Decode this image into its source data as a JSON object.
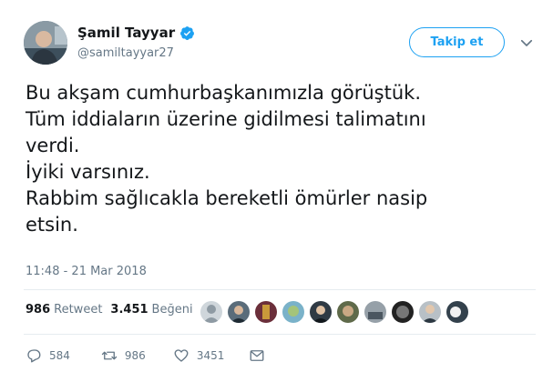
{
  "tweet": {
    "author": {
      "display_name": "Şamil Tayyar",
      "handle": "@samiltayyar27",
      "verified": true,
      "avatar": "avatar-photo"
    },
    "follow_button": "Takip et",
    "menu_icon": "chevron-down-icon",
    "text": "Bu akşam cumhurbaşkanımızla görüştük.\nTüm iddiaların üzerine gidilmesi talimatını\nverdi.\nİyiki varsınız.\nRabbim sağlıcakla bereketli ömürler nasip\netsin.",
    "timestamp": "11:48 - 21 Mar 2018",
    "stats": {
      "retweets_count": "986",
      "retweets_label": "Retweet",
      "likes_count": "3.451",
      "likes_label": "Beğeni"
    },
    "likers_avatar_count": 10,
    "actions": {
      "reply_count": "584",
      "retweet_count": "986",
      "like_count": "3451",
      "reply_icon": "reply-icon",
      "retweet_icon": "retweet-icon",
      "like_icon": "heart-icon",
      "dm_icon": "envelope-icon"
    },
    "colors": {
      "accent": "#1da1f2",
      "text": "#14171a",
      "muted": "#657786"
    }
  }
}
